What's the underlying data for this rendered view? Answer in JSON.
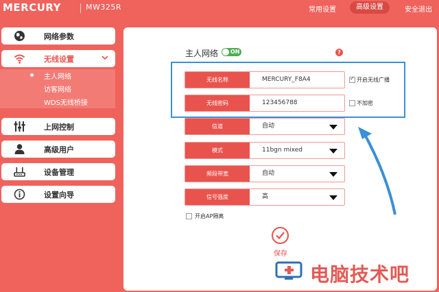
{
  "header": {
    "brand": "MERCURY",
    "model": "MW325R",
    "nav": [
      "常用设置",
      "高级设置",
      "安全退出"
    ],
    "nav_active": "高级设置"
  },
  "sidebar": {
    "items": [
      {
        "label": "网络参数",
        "icon": "globe-icon"
      },
      {
        "label": "无线设置",
        "icon": "wifi-icon",
        "active": true
      },
      {
        "label": "上网控制",
        "icon": "sliders-icon"
      },
      {
        "label": "高级用户",
        "icon": "user-icon"
      },
      {
        "label": "设备管理",
        "icon": "router-icon"
      },
      {
        "label": "设置向导",
        "icon": "info-icon"
      }
    ],
    "submenu": [
      "主人网络",
      "访客网络",
      "WDS无线桥接"
    ],
    "submenu_selected": "主人网络"
  },
  "main": {
    "title": "主人网络",
    "toggle": "ON",
    "fields": [
      {
        "label": "无线名称",
        "value": "MERCURY_F8A4",
        "check_label": "开启无线广播",
        "checked": true
      },
      {
        "label": "无线密码",
        "value": "123456788",
        "check_label": "不加密",
        "checked": false
      }
    ],
    "selects": [
      {
        "label": "信道",
        "value": "自动"
      },
      {
        "label": "模式",
        "value": "11bgn mixed"
      },
      {
        "label": "频段带宽",
        "value": "自动"
      },
      {
        "label": "信号强度",
        "value": "高"
      }
    ],
    "ap_isolation_label": "开启AP隔离",
    "save_label": "保存"
  },
  "watermark": "电脑技术吧",
  "colors": {
    "brand_red": "#f0625c",
    "accent_red": "#e9534d",
    "toggle_green": "#4caf50",
    "highlight_blue": "#3a8fd6"
  }
}
